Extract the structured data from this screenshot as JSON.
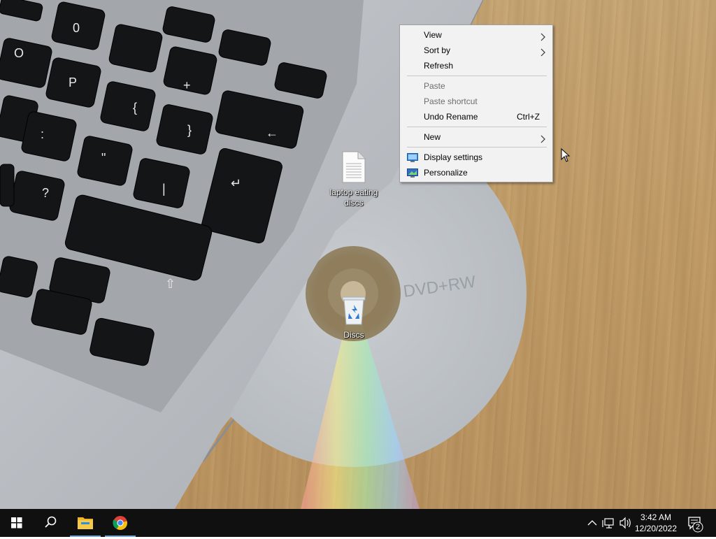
{
  "desktop": {
    "icons": [
      {
        "label": "laptop eating discs",
        "icon": "text-document-icon"
      },
      {
        "label": "Discs",
        "icon": "recycle-bin-icon"
      }
    ]
  },
  "context_menu": {
    "items": {
      "view": "View",
      "sort_by": "Sort by",
      "refresh": "Refresh",
      "paste": "Paste",
      "paste_shortcut": "Paste shortcut",
      "undo_rename": "Undo Rename",
      "undo_rename_shortcut": "Ctrl+Z",
      "new": "New",
      "display_settings": "Display settings",
      "personalize": "Personalize"
    }
  },
  "taskbar": {
    "clock": {
      "time": "3:42 AM",
      "date": "12/20/2022"
    },
    "notification_count": "2",
    "pinned": [
      "windows-start-icon",
      "search-icon",
      "file-explorer-icon",
      "chrome-icon"
    ],
    "accent_color": "#7aa6d6"
  }
}
